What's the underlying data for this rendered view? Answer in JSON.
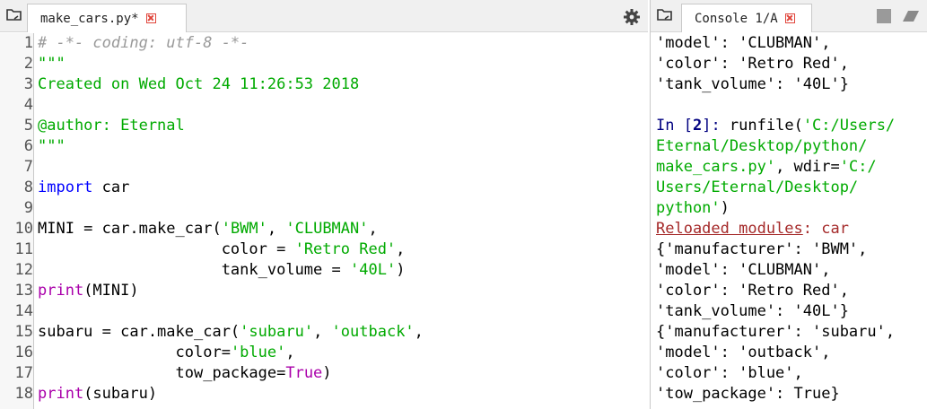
{
  "editor": {
    "tab_label": "make_cars.py*",
    "lines": [
      {
        "n": "1",
        "segments": [
          {
            "t": "# -*- coding: utf-8 -*-",
            "c": "comment"
          }
        ]
      },
      {
        "n": "2",
        "segments": [
          {
            "t": "\"\"\"",
            "c": "string"
          }
        ]
      },
      {
        "n": "3",
        "segments": [
          {
            "t": "Created on Wed Oct 24 11:26:53 2018",
            "c": "string"
          }
        ]
      },
      {
        "n": "4",
        "segments": []
      },
      {
        "n": "5",
        "segments": [
          {
            "t": "@author: Eternal",
            "c": "string"
          }
        ]
      },
      {
        "n": "6",
        "segments": [
          {
            "t": "\"\"\"",
            "c": "string"
          }
        ]
      },
      {
        "n": "7",
        "segments": []
      },
      {
        "n": "8",
        "segments": [
          {
            "t": "import",
            "c": "keyword"
          },
          {
            "t": " car",
            "c": "plain"
          }
        ]
      },
      {
        "n": "9",
        "segments": []
      },
      {
        "n": "10",
        "segments": [
          {
            "t": "MINI = car.make_car(",
            "c": "plain"
          },
          {
            "t": "'BWM'",
            "c": "string"
          },
          {
            "t": ", ",
            "c": "plain"
          },
          {
            "t": "'CLUBMAN'",
            "c": "string"
          },
          {
            "t": ",",
            "c": "plain"
          }
        ]
      },
      {
        "n": "11",
        "segments": [
          {
            "t": "                    color = ",
            "c": "plain"
          },
          {
            "t": "'Retro Red'",
            "c": "string"
          },
          {
            "t": ",",
            "c": "plain"
          }
        ]
      },
      {
        "n": "12",
        "segments": [
          {
            "t": "                    tank_volume = ",
            "c": "plain"
          },
          {
            "t": "'40L'",
            "c": "string"
          },
          {
            "t": ")",
            "c": "plain"
          }
        ]
      },
      {
        "n": "13",
        "segments": [
          {
            "t": "print",
            "c": "builtin"
          },
          {
            "t": "(MINI)",
            "c": "plain"
          }
        ]
      },
      {
        "n": "14",
        "segments": []
      },
      {
        "n": "15",
        "segments": [
          {
            "t": "subaru = car.make_car(",
            "c": "plain"
          },
          {
            "t": "'subaru'",
            "c": "string"
          },
          {
            "t": ", ",
            "c": "plain"
          },
          {
            "t": "'outback'",
            "c": "string"
          },
          {
            "t": ",",
            "c": "plain"
          }
        ]
      },
      {
        "n": "16",
        "segments": [
          {
            "t": "               color=",
            "c": "plain"
          },
          {
            "t": "'blue'",
            "c": "string"
          },
          {
            "t": ",",
            "c": "plain"
          }
        ]
      },
      {
        "n": "17",
        "segments": [
          {
            "t": "               tow_package=",
            "c": "plain"
          },
          {
            "t": "True",
            "c": "builtin"
          },
          {
            "t": ")",
            "c": "plain"
          }
        ]
      },
      {
        "n": "18",
        "segments": [
          {
            "t": "print",
            "c": "builtin"
          },
          {
            "t": "(subaru)",
            "c": "plain"
          }
        ]
      }
    ]
  },
  "console": {
    "tab_label": "Console 1/A",
    "lines": [
      [
        {
          "t": "'model': 'CLUBMAN',",
          "c": "plain"
        }
      ],
      [
        {
          "t": "'color': 'Retro Red',",
          "c": "plain"
        }
      ],
      [
        {
          "t": "'tank_volume': '40L'}",
          "c": "plain"
        }
      ],
      [],
      [
        {
          "t": "In [",
          "c": "prompt"
        },
        {
          "t": "2",
          "c": "prompt-num"
        },
        {
          "t": "]: ",
          "c": "prompt"
        },
        {
          "t": "runfile(",
          "c": "plain"
        },
        {
          "t": "'C:/Users/",
          "c": "green"
        }
      ],
      [
        {
          "t": "Eternal/Desktop/python/",
          "c": "green"
        }
      ],
      [
        {
          "t": "make_cars.py'",
          "c": "green"
        },
        {
          "t": ", wdir=",
          "c": "plain"
        },
        {
          "t": "'C:/",
          "c": "green"
        }
      ],
      [
        {
          "t": "Users/Eternal/Desktop/",
          "c": "green"
        }
      ],
      [
        {
          "t": "python'",
          "c": "green"
        },
        {
          "t": ")",
          "c": "plain"
        }
      ],
      [
        {
          "t": "Reloaded modules",
          "c": "reload"
        },
        {
          "t": ": car",
          "c": "reload-mod"
        }
      ],
      [
        {
          "t": "{'manufacturer': 'BWM',",
          "c": "plain"
        }
      ],
      [
        {
          "t": "'model': 'CLUBMAN',",
          "c": "plain"
        }
      ],
      [
        {
          "t": "'color': 'Retro Red',",
          "c": "plain"
        }
      ],
      [
        {
          "t": "'tank_volume': '40L'}",
          "c": "plain"
        }
      ],
      [
        {
          "t": "{'manufacturer': 'subaru',",
          "c": "plain"
        }
      ],
      [
        {
          "t": "'model': 'outback',",
          "c": "plain"
        }
      ],
      [
        {
          "t": "'color': 'blue',",
          "c": "plain"
        }
      ],
      [
        {
          "t": "'tow_package': True}",
          "c": "plain"
        }
      ]
    ]
  },
  "icons": {
    "pane_icon": "folder-browse-icon",
    "editor_options": "gear-icon",
    "console_stop": "stop-icon",
    "console_clear": "eraser-icon",
    "tab_close": "close-icon"
  },
  "colors": {
    "comment": "#999999",
    "string": "#00aa00",
    "keyword": "#0000ff",
    "builtin": "#aa00aa",
    "prompt": "#000080",
    "reload": "#a52a2a",
    "close": "#e0453b"
  }
}
